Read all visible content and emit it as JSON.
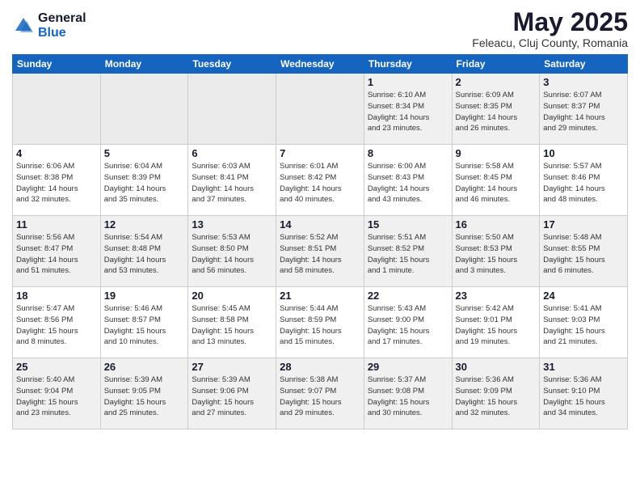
{
  "header": {
    "logo_general": "General",
    "logo_blue": "Blue",
    "title": "May 2025",
    "subtitle": "Feleacu, Cluj County, Romania"
  },
  "weekdays": [
    "Sunday",
    "Monday",
    "Tuesday",
    "Wednesday",
    "Thursday",
    "Friday",
    "Saturday"
  ],
  "weeks": [
    [
      {
        "day": "",
        "info": ""
      },
      {
        "day": "",
        "info": ""
      },
      {
        "day": "",
        "info": ""
      },
      {
        "day": "",
        "info": ""
      },
      {
        "day": "1",
        "info": "Sunrise: 6:10 AM\nSunset: 8:34 PM\nDaylight: 14 hours\nand 23 minutes."
      },
      {
        "day": "2",
        "info": "Sunrise: 6:09 AM\nSunset: 8:35 PM\nDaylight: 14 hours\nand 26 minutes."
      },
      {
        "day": "3",
        "info": "Sunrise: 6:07 AM\nSunset: 8:37 PM\nDaylight: 14 hours\nand 29 minutes."
      }
    ],
    [
      {
        "day": "4",
        "info": "Sunrise: 6:06 AM\nSunset: 8:38 PM\nDaylight: 14 hours\nand 32 minutes."
      },
      {
        "day": "5",
        "info": "Sunrise: 6:04 AM\nSunset: 8:39 PM\nDaylight: 14 hours\nand 35 minutes."
      },
      {
        "day": "6",
        "info": "Sunrise: 6:03 AM\nSunset: 8:41 PM\nDaylight: 14 hours\nand 37 minutes."
      },
      {
        "day": "7",
        "info": "Sunrise: 6:01 AM\nSunset: 8:42 PM\nDaylight: 14 hours\nand 40 minutes."
      },
      {
        "day": "8",
        "info": "Sunrise: 6:00 AM\nSunset: 8:43 PM\nDaylight: 14 hours\nand 43 minutes."
      },
      {
        "day": "9",
        "info": "Sunrise: 5:58 AM\nSunset: 8:45 PM\nDaylight: 14 hours\nand 46 minutes."
      },
      {
        "day": "10",
        "info": "Sunrise: 5:57 AM\nSunset: 8:46 PM\nDaylight: 14 hours\nand 48 minutes."
      }
    ],
    [
      {
        "day": "11",
        "info": "Sunrise: 5:56 AM\nSunset: 8:47 PM\nDaylight: 14 hours\nand 51 minutes."
      },
      {
        "day": "12",
        "info": "Sunrise: 5:54 AM\nSunset: 8:48 PM\nDaylight: 14 hours\nand 53 minutes."
      },
      {
        "day": "13",
        "info": "Sunrise: 5:53 AM\nSunset: 8:50 PM\nDaylight: 14 hours\nand 56 minutes."
      },
      {
        "day": "14",
        "info": "Sunrise: 5:52 AM\nSunset: 8:51 PM\nDaylight: 14 hours\nand 58 minutes."
      },
      {
        "day": "15",
        "info": "Sunrise: 5:51 AM\nSunset: 8:52 PM\nDaylight: 15 hours\nand 1 minute."
      },
      {
        "day": "16",
        "info": "Sunrise: 5:50 AM\nSunset: 8:53 PM\nDaylight: 15 hours\nand 3 minutes."
      },
      {
        "day": "17",
        "info": "Sunrise: 5:48 AM\nSunset: 8:55 PM\nDaylight: 15 hours\nand 6 minutes."
      }
    ],
    [
      {
        "day": "18",
        "info": "Sunrise: 5:47 AM\nSunset: 8:56 PM\nDaylight: 15 hours\nand 8 minutes."
      },
      {
        "day": "19",
        "info": "Sunrise: 5:46 AM\nSunset: 8:57 PM\nDaylight: 15 hours\nand 10 minutes."
      },
      {
        "day": "20",
        "info": "Sunrise: 5:45 AM\nSunset: 8:58 PM\nDaylight: 15 hours\nand 13 minutes."
      },
      {
        "day": "21",
        "info": "Sunrise: 5:44 AM\nSunset: 8:59 PM\nDaylight: 15 hours\nand 15 minutes."
      },
      {
        "day": "22",
        "info": "Sunrise: 5:43 AM\nSunset: 9:00 PM\nDaylight: 15 hours\nand 17 minutes."
      },
      {
        "day": "23",
        "info": "Sunrise: 5:42 AM\nSunset: 9:01 PM\nDaylight: 15 hours\nand 19 minutes."
      },
      {
        "day": "24",
        "info": "Sunrise: 5:41 AM\nSunset: 9:03 PM\nDaylight: 15 hours\nand 21 minutes."
      }
    ],
    [
      {
        "day": "25",
        "info": "Sunrise: 5:40 AM\nSunset: 9:04 PM\nDaylight: 15 hours\nand 23 minutes."
      },
      {
        "day": "26",
        "info": "Sunrise: 5:39 AM\nSunset: 9:05 PM\nDaylight: 15 hours\nand 25 minutes."
      },
      {
        "day": "27",
        "info": "Sunrise: 5:39 AM\nSunset: 9:06 PM\nDaylight: 15 hours\nand 27 minutes."
      },
      {
        "day": "28",
        "info": "Sunrise: 5:38 AM\nSunset: 9:07 PM\nDaylight: 15 hours\nand 29 minutes."
      },
      {
        "day": "29",
        "info": "Sunrise: 5:37 AM\nSunset: 9:08 PM\nDaylight: 15 hours\nand 30 minutes."
      },
      {
        "day": "30",
        "info": "Sunrise: 5:36 AM\nSunset: 9:09 PM\nDaylight: 15 hours\nand 32 minutes."
      },
      {
        "day": "31",
        "info": "Sunrise: 5:36 AM\nSunset: 9:10 PM\nDaylight: 15 hours\nand 34 minutes."
      }
    ]
  ]
}
